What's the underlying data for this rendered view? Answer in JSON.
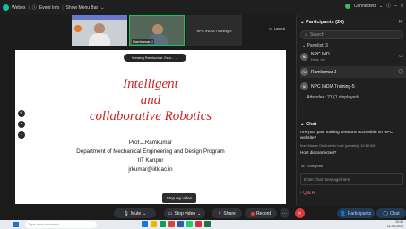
{
  "topbar": {
    "app_name": "Webex",
    "event_info": "Event Info",
    "menu_bar": "Show Menu Bar",
    "connection": "Connected"
  },
  "thumbnails": [
    {
      "name": ""
    },
    {
      "name": "Ramkumar J"
    },
    {
      "name": "NPC INDIA Training-5"
    }
  ],
  "layout_label": "Layout",
  "viewing_pill": "Viewing Ramkumar J's a...",
  "slide": {
    "title_line1": "Intelligent",
    "title_line2": "and",
    "title_line3": "collaborative Robotics",
    "author": "Prof.J.Ramkumar",
    "department": "Department of Mechanical Engineering and Design Program",
    "institute": "IIT Kanpur",
    "email": "jrkumar@iitk.ac.in"
  },
  "tooltip": "Stop my video",
  "controls": {
    "mute": "Mute",
    "stop_video": "Stop video",
    "share": "Share",
    "record": "Record",
    "participants": "Participants",
    "chat": "Chat"
  },
  "panel": {
    "header": "Participants (24)",
    "search_placeholder": "Search",
    "panelists_title": "Panelist: 3",
    "panelists": [
      {
        "initials": "NI",
        "name": "NPC IND...",
        "role": "Host, me"
      },
      {
        "initials": "RJ",
        "name": "Ramkumar J",
        "role": ""
      },
      {
        "initials": "NI",
        "name": "NPC INDIA Training-5",
        "role": ""
      }
    ],
    "attendees_title": "Attendee: 21 (1 displayed)"
  },
  "chat": {
    "header": "Chat",
    "message": "Are your past training sessions accessible on NPC website?",
    "meta": "from Manan De Anter to host (privately)  10:18 AM",
    "message2": "Host disconnected?",
    "send_to_label": "To:",
    "send_to_value": "Everyone",
    "input_placeholder": "Enter chat message here",
    "qa": "Q & A"
  },
  "taskbar": {
    "search_placeholder": "Type here to search",
    "time": "10:40",
    "date": "11-09-2021"
  }
}
